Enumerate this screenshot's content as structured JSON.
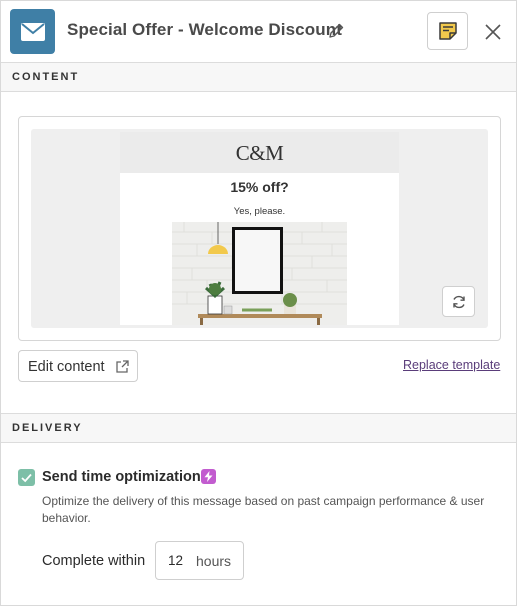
{
  "header": {
    "app_icon": "envelope-icon",
    "title": "Special Offer - Welcome Discount",
    "edit_icon": "pencil-icon",
    "notes_icon": "sticky-note-icon",
    "close_icon": "close-icon"
  },
  "content_section": {
    "heading": "CONTENT",
    "preview": {
      "brand": "C&M",
      "headline": "15% off?",
      "subline": "Yes, please.",
      "refresh_icon": "refresh-icon"
    },
    "edit_button_label": "Edit content",
    "edit_button_icon": "external-link-icon",
    "replace_link": "Replace template"
  },
  "delivery_section": {
    "heading": "DELIVERY",
    "send_time_optimization": {
      "checked": true,
      "label": "Send time optimization",
      "badge_icon": "lightning-bolt-icon",
      "description": "Optimize the delivery of this message based on past campaign performance & user behavior."
    },
    "complete_within": {
      "label": "Complete within",
      "value": "12",
      "unit": "hours"
    }
  },
  "colors": {
    "app_icon_bg": "#3f7fa6",
    "notes_icon": "#e0b21c",
    "checkbox": "#7dbfa7",
    "badge": "#c25ccf",
    "link": "#5a3d7a"
  }
}
